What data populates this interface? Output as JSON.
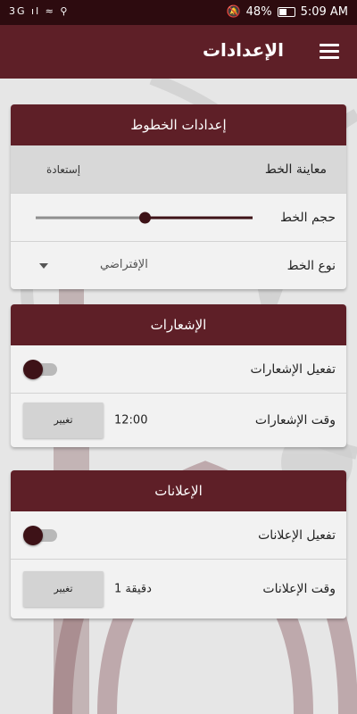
{
  "status_bar": {
    "left_icons": "3G ıl ≈ ⚲",
    "battery_percent": "48%",
    "time": "5:09 AM"
  },
  "app_bar": {
    "title": "الإعدادات",
    "menu_icon": "hamburger-menu-icon"
  },
  "font_settings": {
    "header": "إعدادات الخطوط",
    "preview_label": "معاينة الخط",
    "restore_label": "إستعادة",
    "size_label": "حجم الخط",
    "size_value_fraction": 0.5,
    "type_label": "نوع الخط",
    "type_value": "الإفتراضي"
  },
  "notifications": {
    "header": "الإشعارات",
    "enable_label": "تفعيل الإشعارات",
    "enabled": false,
    "time_label": "وقت الإشعارات",
    "time_value": "12:00",
    "change_label": "تغيير"
  },
  "ads": {
    "header": "الإعلانات",
    "enable_label": "تفعيل الإعلانات",
    "enabled": false,
    "time_label": "وقت الإعلانات",
    "time_value": "1 دقيقة",
    "change_label": "تغيير"
  },
  "colors": {
    "primary": "#5e1f27",
    "status_bar": "#2d0b0f",
    "accent": "#3d1217"
  }
}
